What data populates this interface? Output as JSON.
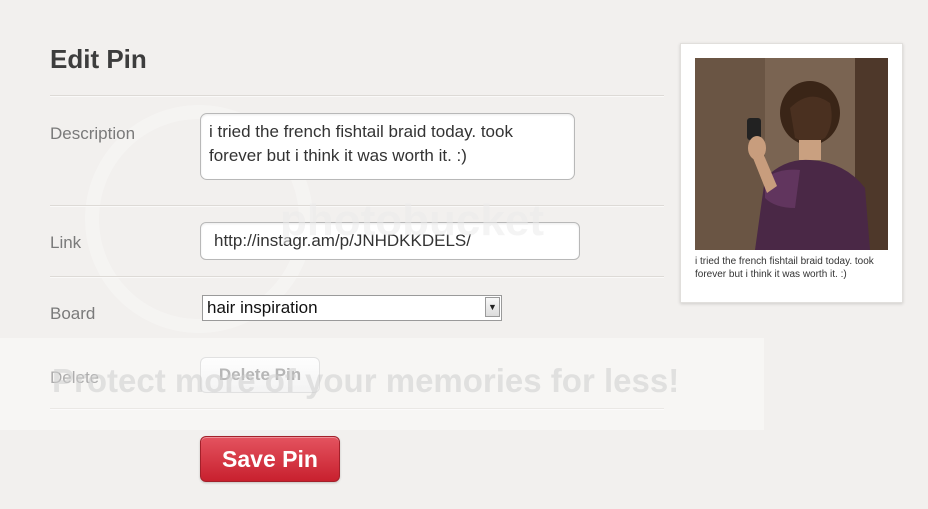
{
  "page": {
    "title": "Edit Pin"
  },
  "form": {
    "description_label": "Description",
    "description_value": "i tried the french fishtail braid today. took forever but i think it was worth it. :)",
    "link_label": "Link",
    "link_value": "http://instagr.am/p/JNHDKKDELS/",
    "board_label": "Board",
    "board_value": "hair inspiration",
    "delete_label": "Delete",
    "delete_button": "Delete Pin",
    "save_button": "Save Pin"
  },
  "preview": {
    "caption": "i tried the french fishtail braid today. took forever but i think it was worth it. :)"
  },
  "watermark": {
    "tagline": "Protect more of your memories for less!",
    "brand": "photobucket"
  },
  "colors": {
    "save_button": "#d3303c",
    "background": "#f2f0ee"
  }
}
